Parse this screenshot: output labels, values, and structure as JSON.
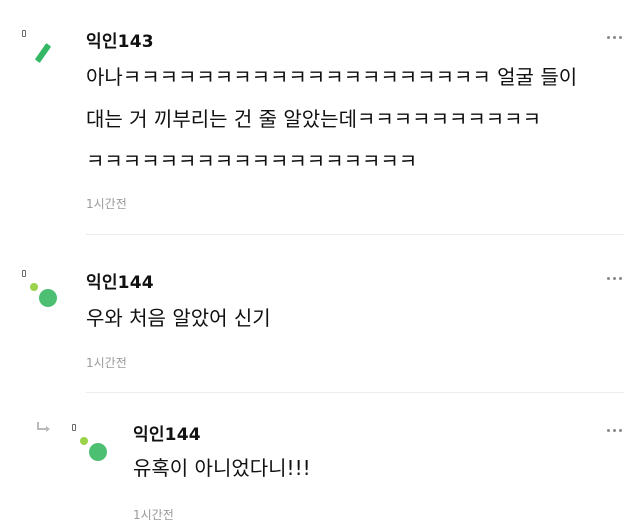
{
  "comments": [
    {
      "author": "익인143",
      "lines": [
        "아나ㅋㅋㅋㅋㅋㅋㅋㅋㅋㅋㅋㅋㅋㅋㅋㅋㅋㅋㅋㅋ 얼굴 들이",
        "대는 거 끼부리는 건 줄 알았는데ㅋㅋㅋㅋㅋㅋㅋㅋㅋㅋ",
        "ㅋㅋㅋㅋㅋㅋㅋㅋㅋㅋㅋㅋㅋㅋㅋㅋㅋㅋ"
      ],
      "time": "1시간전"
    },
    {
      "author": "익인144",
      "lines": [
        "우와 처음 알았어 신기"
      ],
      "time": "1시간전"
    },
    {
      "author": "익인144",
      "lines": [
        "유혹이 아니었다니!!!"
      ],
      "time": "1시간전",
      "is_reply": true
    }
  ],
  "icons": {
    "more": "more-options-icon",
    "reply": "reply-arrow-icon"
  },
  "colors": {
    "avatar_green": "#4cbf72",
    "avatar_dot": "#9ad24a",
    "time_text": "#9a9a9a"
  }
}
